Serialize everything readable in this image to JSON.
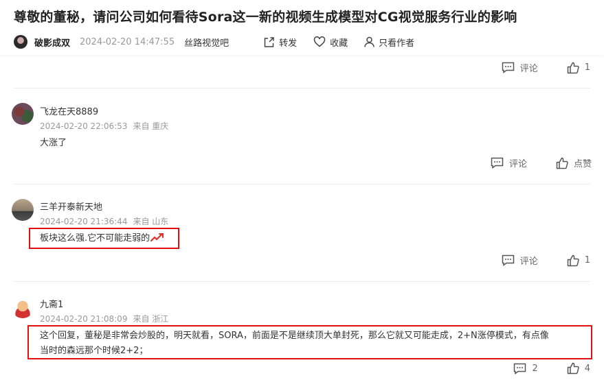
{
  "post": {
    "title": "尊敬的董秘，请问公司如何看待Sora这一新的视频生成模型对CG视觉服务行业的影响",
    "author": "破影成双",
    "time": "2024-02-20 14:47:55",
    "forum": "丝路视觉吧",
    "share_label": "转发",
    "favorite_label": "收藏",
    "author_only_label": "只看作者"
  },
  "previous_actions": {
    "comment_label": "评论",
    "like_count": "1"
  },
  "comments": [
    {
      "name": "飞龙在天8889",
      "time": "2024-02-20 22:06:53",
      "location": "来自 重庆",
      "text": "大涨了",
      "comment_label": "评论",
      "like_label": "点赞"
    },
    {
      "name": "三羊开泰新天地",
      "time": "2024-02-20 21:36:44",
      "location": "来自 山东",
      "text": "板块这么强.它不可能走弱的",
      "comment_label": "评论",
      "like_label": "1"
    },
    {
      "name": "九斋1",
      "time": "2024-02-20 21:08:09",
      "location": "来自 浙江",
      "text_line1": "这个回复，董秘是非常会炒股的，明天就看，SORA，前面是不是继续顶大单封死，那么它就又可能走成，2+N涨停模式，有点像",
      "text_line2": "当时的森远那个时候2+2；",
      "comment_label": "2",
      "like_label": "4"
    }
  ],
  "colors": {
    "highlight": "#e01010",
    "trend_icon": "#e0302a"
  },
  "icons": [
    "share-icon",
    "heart-icon",
    "user-icon",
    "comment-icon",
    "thumbs-up-icon",
    "trend-up-icon"
  ]
}
